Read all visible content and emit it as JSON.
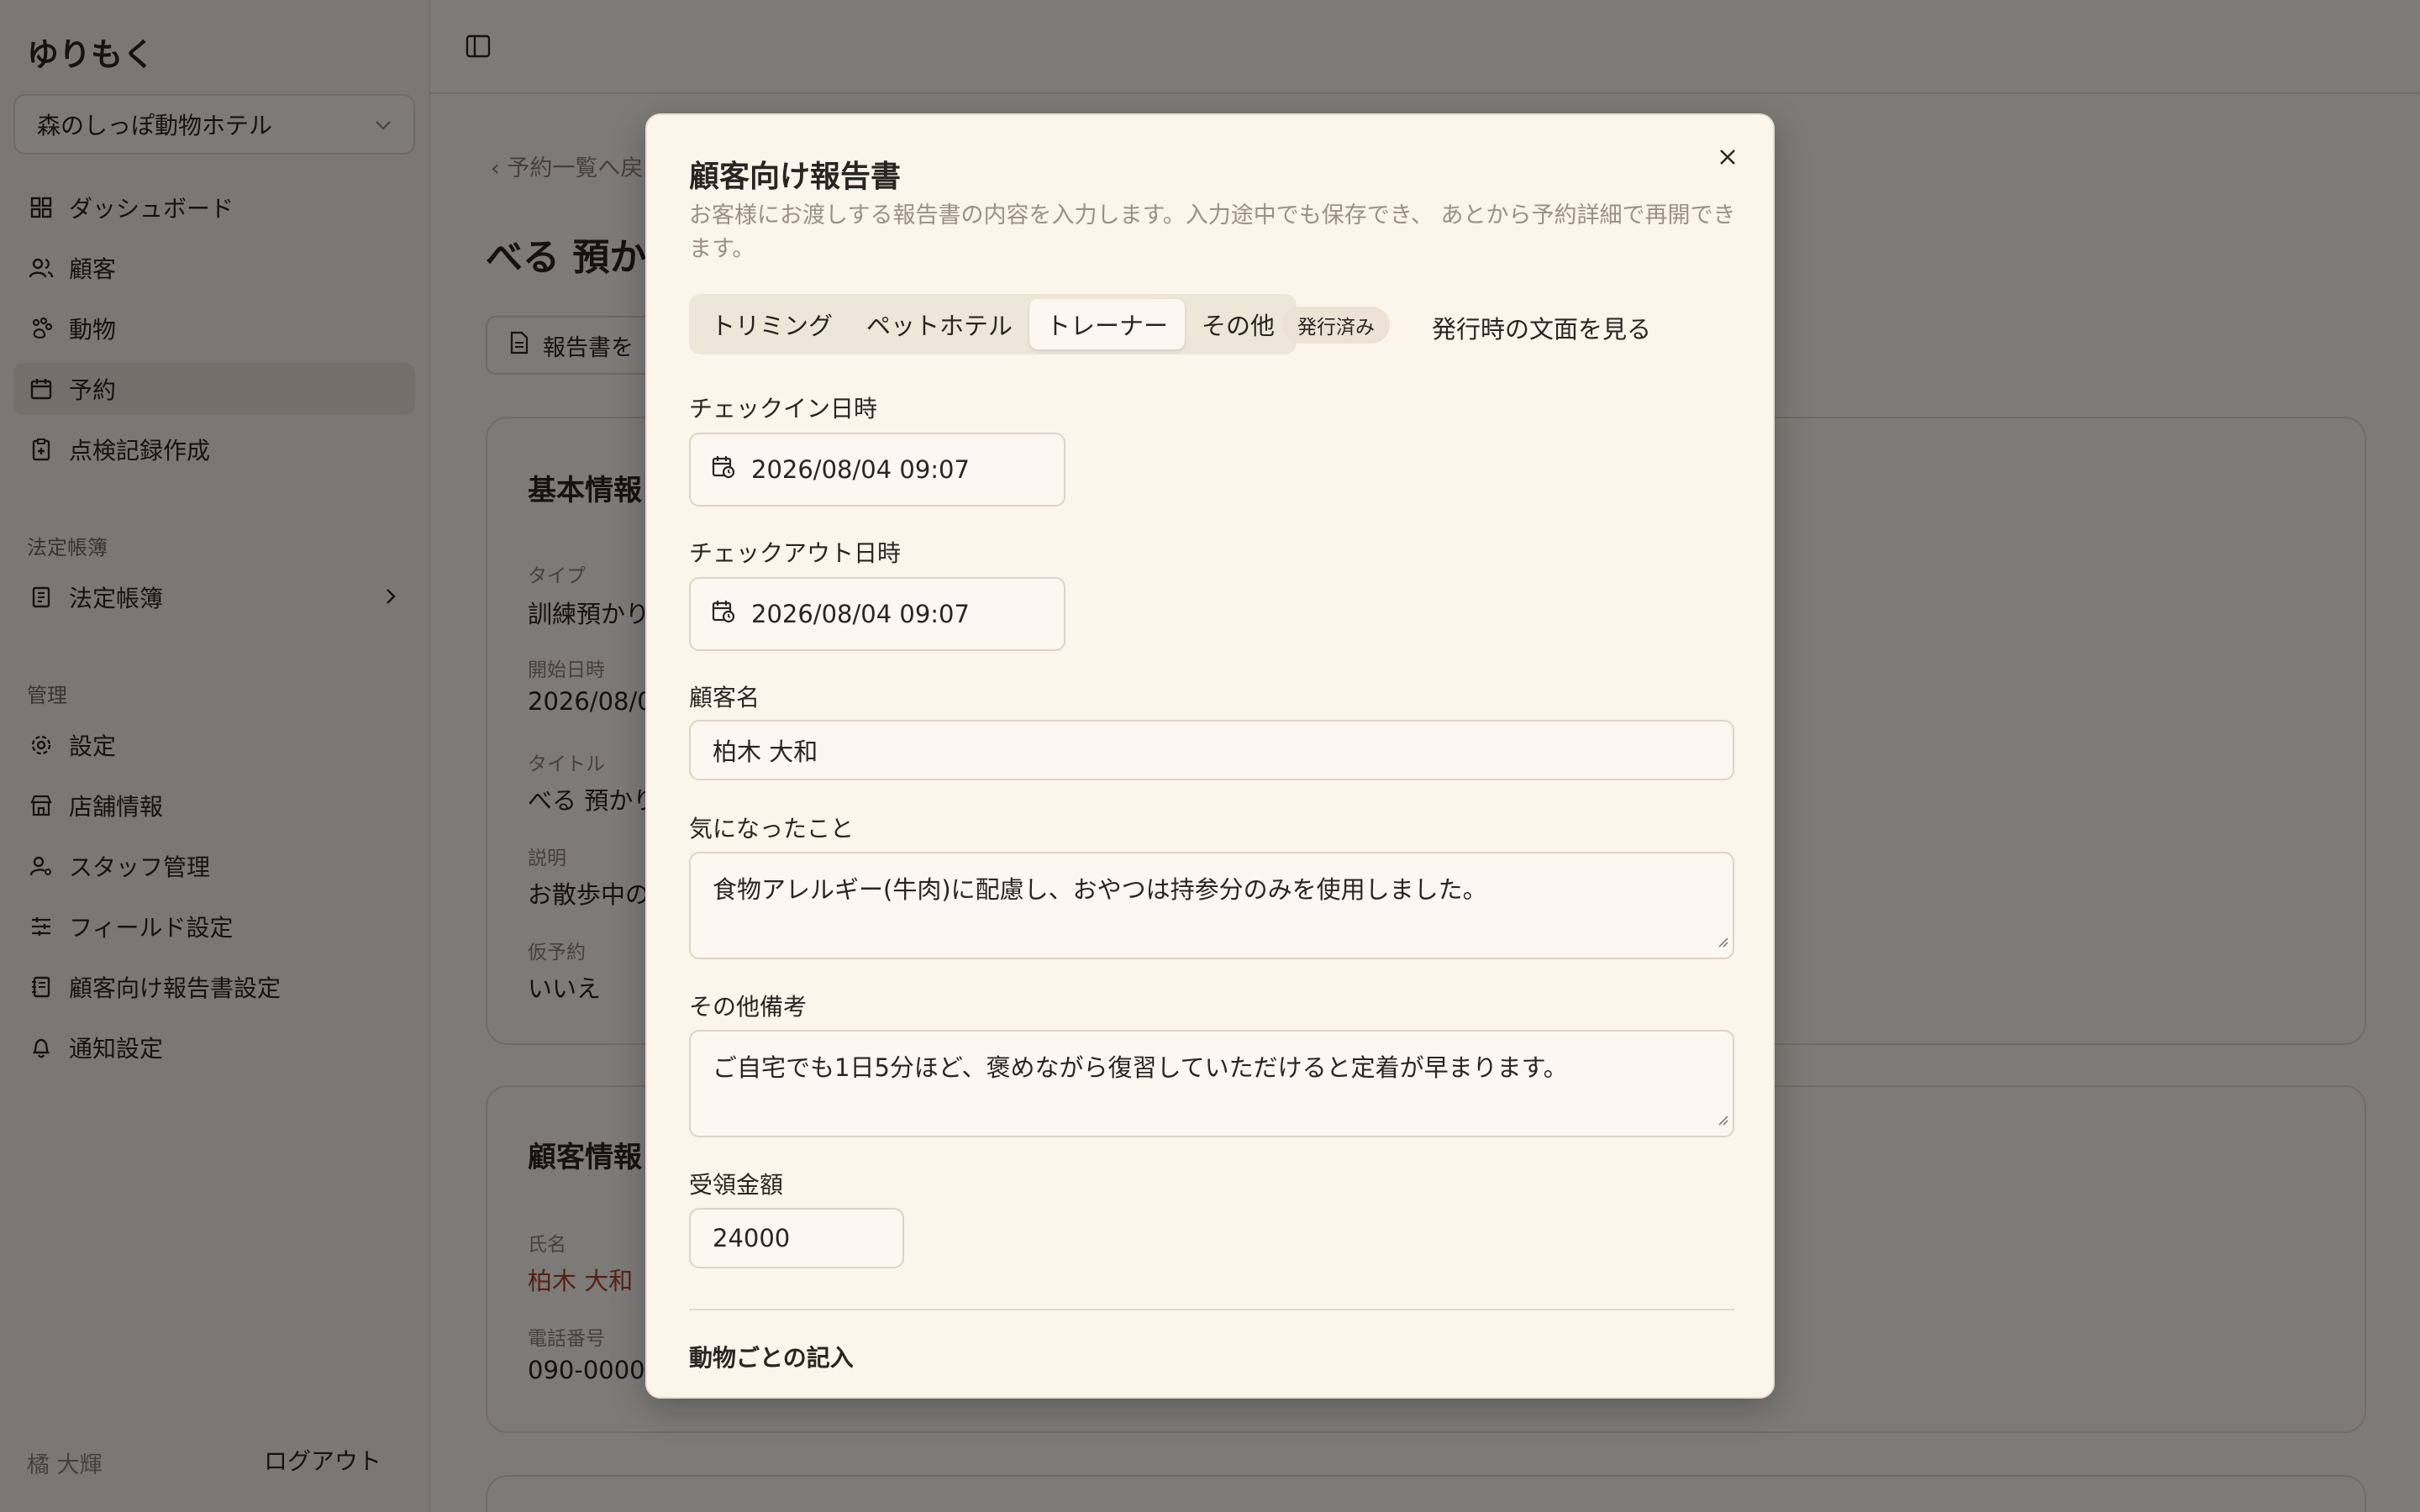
{
  "sidebar": {
    "brand": "ゆりもく",
    "store": "森のしっぽ動物ホテル",
    "items": [
      {
        "label": "ダッシュボード",
        "icon": "dashboard-icon"
      },
      {
        "label": "顧客",
        "icon": "users-icon"
      },
      {
        "label": "動物",
        "icon": "paw-icon"
      },
      {
        "label": "予約",
        "icon": "calendar-icon"
      },
      {
        "label": "点検記録作成",
        "icon": "clipboard-icon"
      }
    ],
    "group_legal": "法定帳簿",
    "legal_item": "法定帳簿",
    "group_admin": "管理",
    "admin_items": [
      {
        "label": "設定",
        "icon": "gear-icon"
      },
      {
        "label": "店舗情報",
        "icon": "store-icon"
      },
      {
        "label": "スタッフ管理",
        "icon": "staff-icon"
      },
      {
        "label": "フィールド設定",
        "icon": "sliders-icon"
      },
      {
        "label": "顧客向け報告書設定",
        "icon": "report-settings-icon"
      },
      {
        "label": "通知設定",
        "icon": "bell-icon"
      }
    ],
    "user": "橘 大輝",
    "logout": "ログアウト"
  },
  "main": {
    "back": "予約一覧へ戻",
    "title": "べる 預か",
    "report_button": "報告書を",
    "basic_card": {
      "title": "基本情報",
      "fields": [
        {
          "label": "タイプ",
          "value": "訓練預かり"
        },
        {
          "label": "開始日時",
          "value": "2026/08/0"
        },
        {
          "label": "タイトル",
          "value": "べる 預かり"
        },
        {
          "label": "説明",
          "value": "お散歩中の"
        },
        {
          "label": "仮予約",
          "value": "いいえ"
        }
      ]
    },
    "customer_card": {
      "title": "顧客情報",
      "fields": [
        {
          "label": "氏名",
          "value": "柏木 大和"
        },
        {
          "label": "電話番号",
          "value": "090-0000"
        }
      ]
    }
  },
  "modal": {
    "title": "顧客向け報告書",
    "description": "お客様にお渡しする報告書の内容を入力します。入力途中でも保存でき、 あとから予約詳細で再開できます。",
    "tabs": [
      "トリミング",
      "ペットホテル",
      "トレーナー",
      "その他"
    ],
    "active_tab": "トレーナー",
    "badge": "発行済み",
    "view_issued": "発行時の文面を見る",
    "checkin_label": "チェックイン日時",
    "checkin_value": "2026/08/04 09:07",
    "checkout_label": "チェックアウト日時",
    "checkout_value": "2026/08/04 09:07",
    "customer_label": "顧客名",
    "customer_value": "柏木 大和",
    "concern_label": "気になったこと",
    "concern_value": "食物アレルギー(牛肉)に配慮し、おやつは持参分のみを使用しました。",
    "notes_label": "その他備考",
    "notes_value": "ご自宅でも1日5分ほど、褒めながら復習していただけると定着が早まります。",
    "amount_label": "受領金額",
    "amount_value": "24000",
    "section_head": "動物ごとの記入"
  },
  "colors": {
    "background": "#fbf6ee",
    "accent_link": "#a8432d",
    "overlay": "rgba(0,0,0,0.5)"
  }
}
